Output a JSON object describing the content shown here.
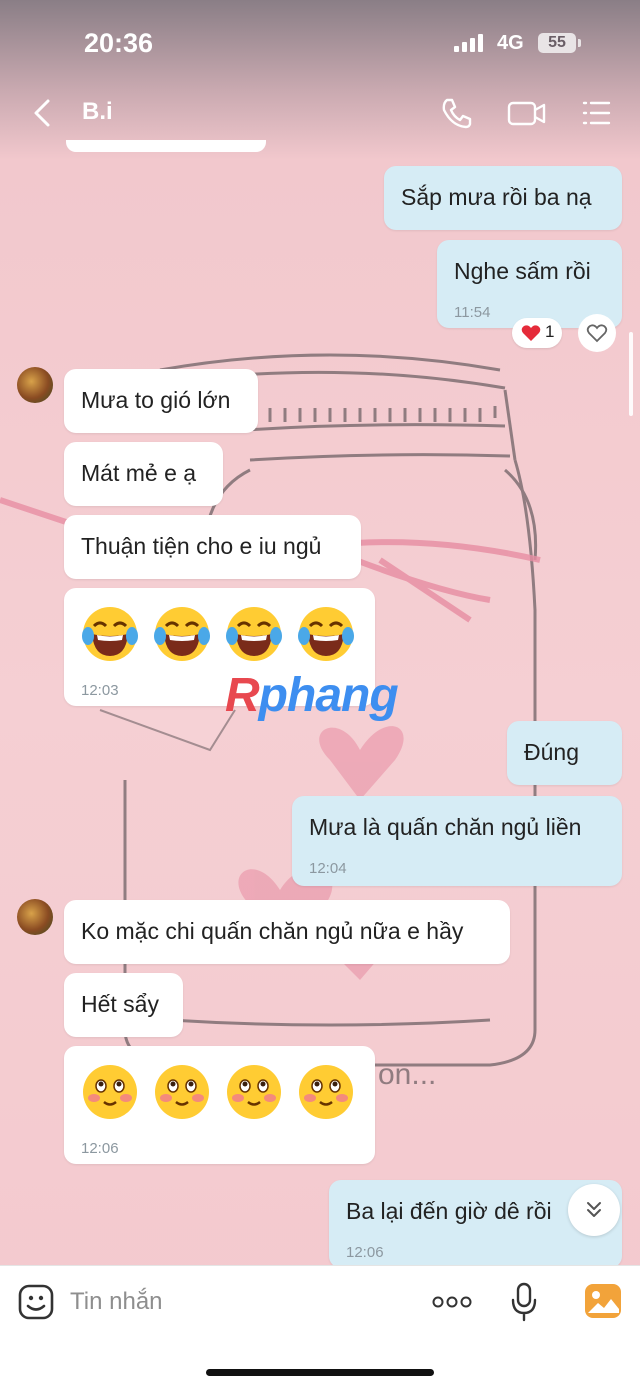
{
  "status": {
    "time": "20:36",
    "network": "4G",
    "battery": "55"
  },
  "header": {
    "contact_name": "B.i"
  },
  "messages": {
    "m1": "Sắp mưa rồi ba nạ",
    "m2": "Nghe sấm rồi",
    "m2_time": "11:54",
    "m2_reaction_count": "1",
    "r1": "Mưa to gió lớn",
    "r2": "Mát mẻ e ạ",
    "r3": "Thuận tiện cho e iu ngủ",
    "r4_time": "12:03",
    "m3": "Đúng",
    "m4": "Mưa là quấn chăn ngủ liền",
    "m4_time": "12:04",
    "r5": "Ko mặc chi quấn chăn ngủ nữa e hầy",
    "r6": "Hết sẩy",
    "r7_time": "12:06",
    "m5": "Ba lại đến giờ dê rồi",
    "m5_time": "12:06"
  },
  "background_text": "on...",
  "watermark": {
    "r": "R",
    "rest": "phang"
  },
  "input": {
    "placeholder": "Tin nhắn"
  },
  "colors": {
    "outgoing_bubble": "#d6ecf5",
    "incoming_bubble": "#ffffff",
    "background": "#f4cdd2",
    "accent": "#f0a030"
  }
}
